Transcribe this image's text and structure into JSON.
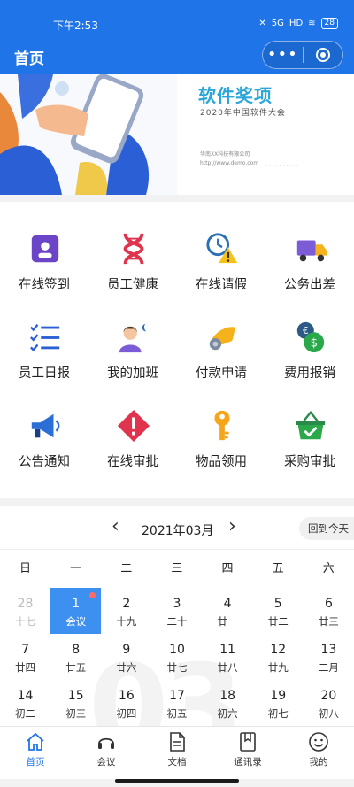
{
  "status_bar": {
    "time": "下午2:53",
    "signal_1": "5G",
    "signal_2": "HD",
    "battery": "28"
  },
  "header": {
    "title": "首页",
    "menu_glyph": "•••"
  },
  "banner": {
    "title": "软件奖项",
    "subtitle": "2020年中国软件大会",
    "company": "华南XX科技有限公司",
    "url": "http://www.demo.com"
  },
  "grid": [
    {
      "label": "在线签到",
      "icon": "sign-in-icon"
    },
    {
      "label": "员工健康",
      "icon": "dna-icon"
    },
    {
      "label": "在线请假",
      "icon": "clock-warning-icon"
    },
    {
      "label": "公务出差",
      "icon": "truck-icon"
    },
    {
      "label": "员工日报",
      "icon": "checklist-icon"
    },
    {
      "label": "我的加班",
      "icon": "night-person-icon"
    },
    {
      "label": "付款申请",
      "icon": "hand-coin-icon"
    },
    {
      "label": "费用报销",
      "icon": "money-icon"
    },
    {
      "label": "公告通知",
      "icon": "megaphone-icon"
    },
    {
      "label": "在线审批",
      "icon": "alert-icon"
    },
    {
      "label": "物品领用",
      "icon": "key-icon"
    },
    {
      "label": "采购审批",
      "icon": "basket-icon"
    }
  ],
  "calendar": {
    "month": "2021年03月",
    "prev": "‹",
    "next": "›",
    "today_label": "回到今天",
    "weekdays": [
      "日",
      "一",
      "二",
      "三",
      "四",
      "五",
      "六"
    ],
    "watermark": "03",
    "days": [
      {
        "n": "28",
        "l": "十七",
        "other": true
      },
      {
        "n": "1",
        "l": "会议",
        "selected": true,
        "dot": true
      },
      {
        "n": "2",
        "l": "十九"
      },
      {
        "n": "3",
        "l": "二十"
      },
      {
        "n": "4",
        "l": "廿一"
      },
      {
        "n": "5",
        "l": "廿二"
      },
      {
        "n": "6",
        "l": "廿三"
      },
      {
        "n": "7",
        "l": "廿四"
      },
      {
        "n": "8",
        "l": "廿五"
      },
      {
        "n": "9",
        "l": "廿六"
      },
      {
        "n": "10",
        "l": "廿七"
      },
      {
        "n": "11",
        "l": "廿八"
      },
      {
        "n": "12",
        "l": "廿九"
      },
      {
        "n": "13",
        "l": "二月"
      },
      {
        "n": "14",
        "l": "初二"
      },
      {
        "n": "15",
        "l": "初三"
      },
      {
        "n": "16",
        "l": "初四"
      },
      {
        "n": "17",
        "l": "初五"
      },
      {
        "n": "18",
        "l": "初六"
      },
      {
        "n": "19",
        "l": "初七"
      },
      {
        "n": "20",
        "l": "初八"
      }
    ]
  },
  "tabbar": [
    {
      "label": "首页",
      "icon": "home-icon",
      "active": true
    },
    {
      "label": "会议",
      "icon": "headset-icon"
    },
    {
      "label": "文档",
      "icon": "document-icon"
    },
    {
      "label": "通讯录",
      "icon": "contacts-icon"
    },
    {
      "label": "我的",
      "icon": "smile-icon"
    }
  ],
  "colors": {
    "primary": "#1f74e8",
    "selected_day": "#3d8ff0",
    "event_dot": "#ff6b6b"
  }
}
